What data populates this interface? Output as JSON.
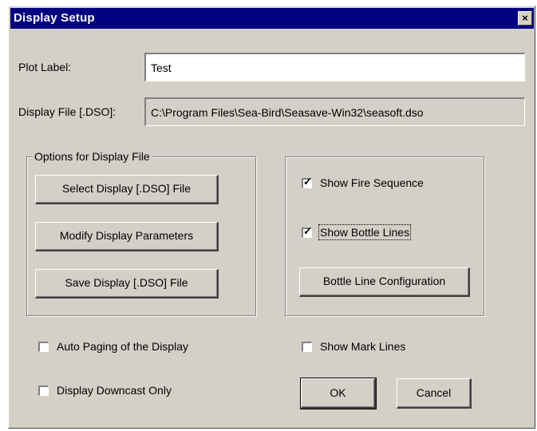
{
  "window": {
    "title": "Display Setup",
    "close_glyph": "×"
  },
  "plot_label": {
    "label": "Plot Label:",
    "value": "Test"
  },
  "display_file": {
    "label": "Display File [.DSO]:",
    "value": "C:\\Program Files\\Sea-Bird\\Seasave-Win32\\seasoft.dso"
  },
  "options_group": {
    "title": "Options for Display File",
    "select_btn": "Select Display [.DSO] File",
    "modify_btn": "Modify Display Parameters",
    "save_btn": "Save Display [.DSO] File"
  },
  "bottle_group": {
    "show_fire_sequence": {
      "label": "Show Fire Sequence",
      "checked": true
    },
    "show_bottle_lines": {
      "label": "Show Bottle Lines",
      "checked": true
    },
    "config_btn": "Bottle Line Configuration"
  },
  "auto_paging": {
    "label": "Auto Paging of the Display",
    "checked": false
  },
  "downcast_only": {
    "label": "Display Downcast Only",
    "checked": false
  },
  "show_mark_lines": {
    "label": "Show Mark Lines",
    "checked": false
  },
  "ok_btn": "OK",
  "cancel_btn": "Cancel",
  "tick_glyph": "✓"
}
